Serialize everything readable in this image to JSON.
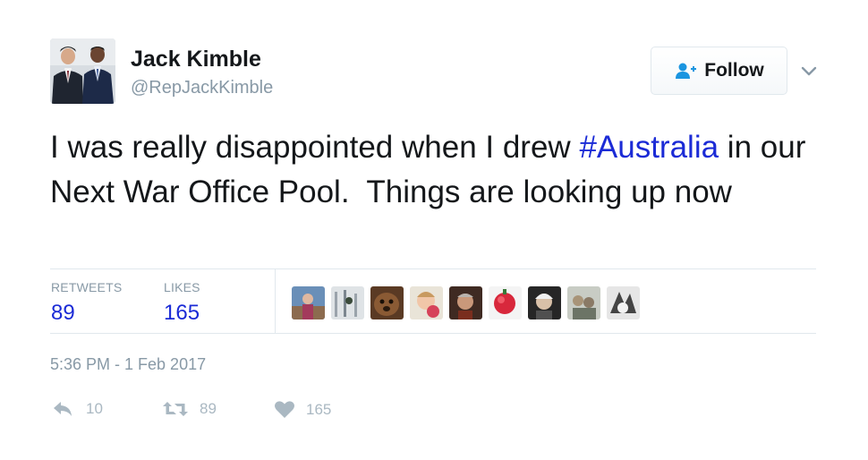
{
  "author": {
    "display_name": "Jack Kimble",
    "screen_name": "@RepJackKimble"
  },
  "follow_button": {
    "label": "Follow",
    "icon": "follow-user-icon"
  },
  "more_menu": {
    "icon": "chevron-down-icon"
  },
  "tweet": {
    "text_before": "I was really disappointed when I drew ",
    "hashtag": "#Australia",
    "text_after": " in our Next War Office Pool.  Things are looking up now"
  },
  "stats": {
    "retweets_label": "RETWEETS",
    "retweets_value": "89",
    "likes_label": "LIKES",
    "likes_value": "165"
  },
  "timestamp": "5:36 PM - 1 Feb 2017",
  "actions": {
    "reply": {
      "icon": "reply-icon",
      "count": "10"
    },
    "retweet": {
      "icon": "retweet-icon",
      "count": "89"
    },
    "like": {
      "icon": "heart-icon",
      "count": "165"
    }
  },
  "colors": {
    "link": "#1b2bd6",
    "muted": "#8899a6",
    "action": "#aab8c2",
    "text": "#14171a",
    "border": "#e1e8ed"
  }
}
